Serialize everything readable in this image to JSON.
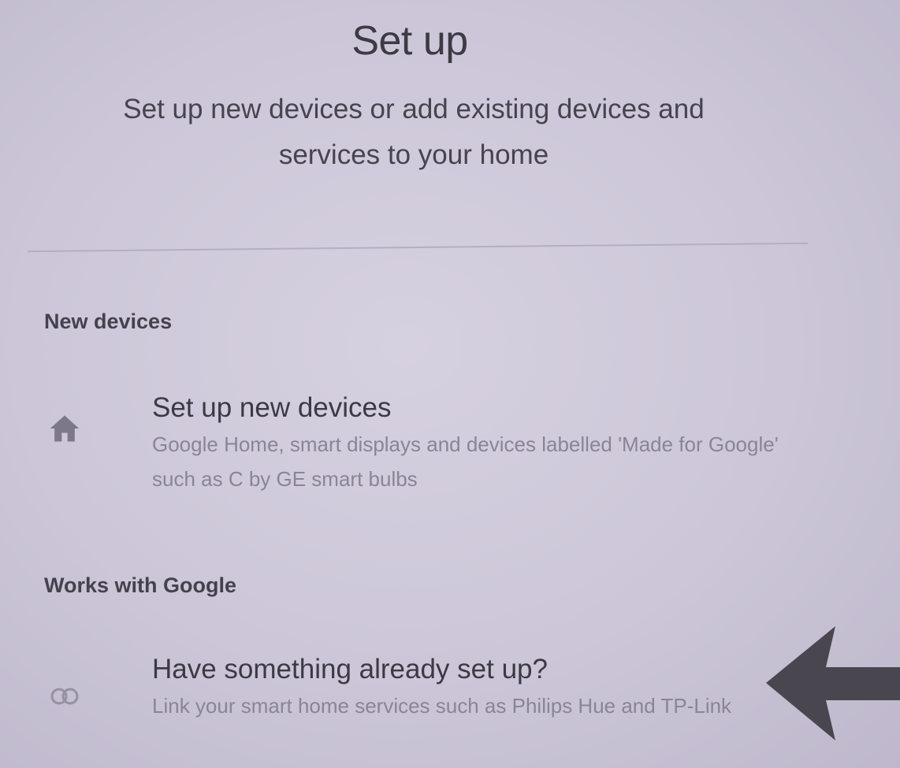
{
  "header": {
    "title": "Set up",
    "subtitle": "Set up new devices or add existing devices and services to your home"
  },
  "sections": [
    {
      "header": "New devices",
      "item": {
        "icon": "home-icon",
        "title": "Set up new devices",
        "description": "Google Home, smart displays and devices labelled 'Made for Google' such as C by GE smart bulbs"
      }
    },
    {
      "header": "Works with Google",
      "item": {
        "icon": "link-icon",
        "title": "Have something already set up?",
        "description": "Link your smart home services such as Philips Hue and TP-Link"
      }
    }
  ],
  "annotation": {
    "icon": "arrow-left-icon",
    "color": "#4a4650"
  },
  "colors": {
    "background": "#cdc7d8",
    "title_text": "#3d3a44",
    "secondary_text": "#8a8497"
  }
}
